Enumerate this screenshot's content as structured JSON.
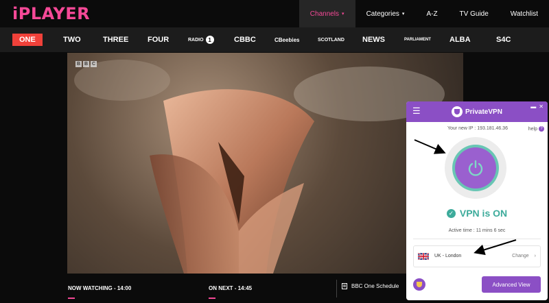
{
  "iplayer": {
    "logo": "iPLAYER",
    "nav": [
      {
        "label": "Channels",
        "caret": "▾",
        "active": true
      },
      {
        "label": "Categories",
        "caret": "▾",
        "active": false
      },
      {
        "label": "A-Z",
        "caret": "",
        "active": false
      },
      {
        "label": "TV Guide",
        "caret": "",
        "active": false
      },
      {
        "label": "Watchlist",
        "caret": "",
        "active": false
      }
    ],
    "channels": {
      "one": "ONE",
      "two": "TWO",
      "three": "THREE",
      "four": "FOUR",
      "radio": "RADIO",
      "radio_num": "1",
      "cbbc": "CBBC",
      "cbeebies": "CBeebies",
      "scotland": "SCOTLAND",
      "news": "NEWS",
      "parliament": "PARLIAMENT",
      "alba": "ALBA",
      "s4c": "S4C"
    },
    "video": {
      "watermark": [
        "B",
        "B",
        "C"
      ]
    },
    "bottom": {
      "now_watching": "NOW WATCHING - 14:00",
      "on_next": "ON NEXT - 14:45",
      "schedule": "BBC One Schedule"
    },
    "accent": "#f54997"
  },
  "vpn": {
    "brand": "PrivateVPN",
    "ip_text": "Your new IP : 193.181.46.36",
    "help": "help",
    "help_icon": "?",
    "status": "VPN is ON",
    "active_time": "Active time :  11 mins 6 sec",
    "location": "UK - London",
    "change": "Change",
    "change_chevron": "›",
    "advanced": "Advanced View",
    "colors": {
      "purple": "#8b4fc5",
      "teal": "#3dab9b"
    }
  }
}
